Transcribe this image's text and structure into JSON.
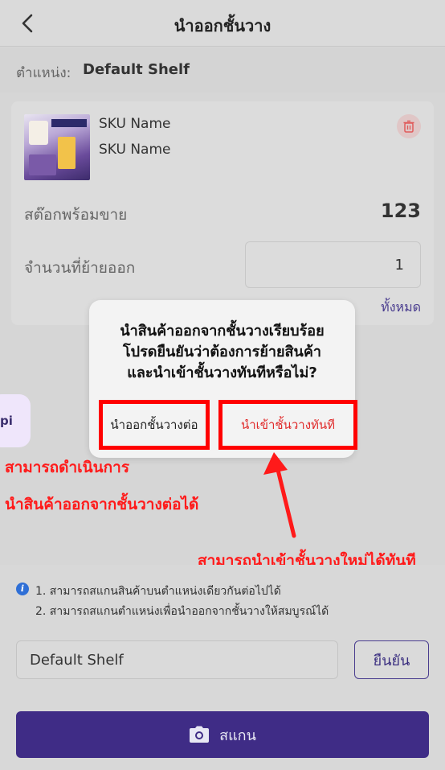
{
  "header": {
    "title": "นำออกชั้นวาง",
    "back_icon": "chevron-left-icon"
  },
  "location": {
    "label": "ตำแหน่ง:",
    "value": "Default Shelf"
  },
  "item": {
    "sku_name_1": "SKU Name",
    "sku_name_2": "SKU Name",
    "stock_label": "สต๊อกพร้อมขาย",
    "stock_value": "123",
    "move_label": "จำนวนที่ย้ายออก",
    "move_value": "1",
    "all_link": "ทั้งหมด",
    "delete_icon": "trash-icon"
  },
  "side_button": {
    "label": "pi"
  },
  "dialog": {
    "message_lines": [
      "นำสินค้าออกจากชั้นวางเรียบร้อย",
      "โปรดยืนยันว่าต้องการย้ายสินค้า",
      "และนำเข้าชั้นวางทันทีหรือไม่?"
    ],
    "continue_button": "นำออกชั้นวางต่อ",
    "putaway_button": "นำเข้าชั้นวางทันที"
  },
  "annotations": {
    "left_line1": "สามารถดำเนินการ",
    "left_line2": "นำสินค้าออกจากชั้นวางต่อได้",
    "right": "สามารถนำเข้าชั้นวางใหม่ได้ทันที",
    "color": "#ff1a1a"
  },
  "tips": {
    "line1": "1. สามารถสแกนสินค้าบนตำแหน่งเดียวกันต่อไปได้",
    "line2": "2. สามารถสแกนตำแหน่งเพื่อนำออกจากชั้นวางให้สมบูรณ์ได้"
  },
  "shelf_input": {
    "value": "Default Shelf"
  },
  "confirm_button": "ยืนยัน",
  "scan_button": {
    "label": "สแกน",
    "icon": "camera-icon"
  },
  "colors": {
    "primary": "#3f2c86",
    "danger": "#e02a2a",
    "highlight": "#ff0000"
  }
}
